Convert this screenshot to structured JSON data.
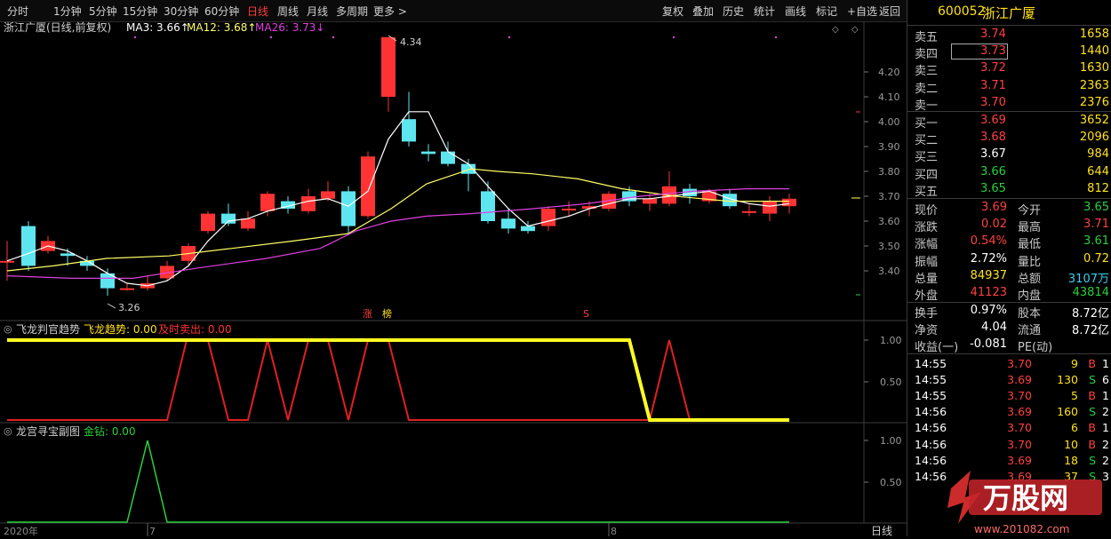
{
  "toolbar": {
    "periods": [
      "分时",
      "1分钟",
      "5分钟",
      "15分钟",
      "30分钟",
      "60分钟",
      "日线",
      "周线",
      "月线",
      "多周期",
      "更多 >"
    ],
    "active_period": "日线",
    "actions": [
      "复权",
      "叠加",
      "历史",
      "统计",
      "画线",
      "标记",
      "+自选",
      "返回"
    ]
  },
  "stock": {
    "code": "600052",
    "name": "浙江广厦"
  },
  "main_chart": {
    "legend_title": "浙江广厦(日线,前复权)",
    "ma3": "MA3: 3.66↑",
    "ma12": "MA12: 3.68↑",
    "ma26": "MA26: 3.73↓",
    "high_label": "4.34",
    "low_label": "3.26",
    "y_ticks": [
      "4.20",
      "4.10",
      "4.00",
      "3.90",
      "3.80",
      "3.70",
      "3.60",
      "3.50",
      "3.40"
    ],
    "marker_zhang": "涨",
    "marker_bang": "榜",
    "marker_s": "S",
    "colors": {
      "up": "#ff3333",
      "down": "#5ee6f0",
      "ma3": "#ffffff",
      "ma12": "#ffff66",
      "ma26": "#e040e0"
    }
  },
  "sub_chart1": {
    "title": "飞龙判官趋势",
    "trend_label": "飞龙趋势: 0.00",
    "sell_label": "及时卖出: 0.00",
    "y_ticks": [
      "1.00",
      "0.50"
    ]
  },
  "sub_chart2": {
    "title": "龙宫寻宝副图",
    "gold_label": "金钻: 0.00",
    "y_ticks": [
      "1.00",
      "0.50"
    ]
  },
  "x_axis": {
    "labels": [
      "2020年",
      "7",
      "8"
    ],
    "period_label": "日线"
  },
  "order_book": {
    "sell": [
      {
        "label": "卖五",
        "price": "3.74",
        "vol": "1658"
      },
      {
        "label": "卖四",
        "price": "3.73",
        "vol": "1440"
      },
      {
        "label": "卖三",
        "price": "3.72",
        "vol": "1630"
      },
      {
        "label": "卖二",
        "price": "3.71",
        "vol": "2363"
      },
      {
        "label": "卖一",
        "price": "3.70",
        "vol": "2376"
      }
    ],
    "buy": [
      {
        "label": "买一",
        "price": "3.69",
        "vol": "3652"
      },
      {
        "label": "买二",
        "price": "3.68",
        "vol": "2096"
      },
      {
        "label": "买三",
        "price": "3.67",
        "vol": "984"
      },
      {
        "label": "买四",
        "price": "3.66",
        "vol": "644"
      },
      {
        "label": "买五",
        "price": "3.65",
        "vol": "812"
      }
    ]
  },
  "quote": {
    "xianjia_l": "现价",
    "xianjia": "3.69",
    "jinkai_l": "今开",
    "jinkai": "3.65",
    "zhangdie_l": "涨跌",
    "zhangdie": "0.02",
    "zuigao_l": "最高",
    "zuigao": "3.71",
    "zhangfu_l": "涨幅",
    "zhangfu": "0.54%",
    "zuidi_l": "最低",
    "zuidi": "3.61",
    "zhenfu_l": "振幅",
    "zhenfu": "2.72%",
    "liangbi_l": "量比",
    "liangbi": "0.72",
    "zongliang_l": "总量",
    "zongliang": "84937",
    "zonge_l": "总额",
    "zonge": "3107万",
    "waipan_l": "外盘",
    "waipan": "41123",
    "neipan_l": "内盘",
    "neipan": "43814",
    "huanshou_l": "换手",
    "huanshou": "0.97%",
    "guben_l": "股本",
    "guben": "8.72亿",
    "jingzi_l": "净资",
    "jingzi": "4.04",
    "liutong_l": "流通",
    "liutong": "8.72亿",
    "shouyi_l": "收益(一)",
    "shouyi": "-0.081",
    "pe_l": "PE(动)",
    "pe": ""
  },
  "ticks": [
    {
      "time": "14:55",
      "price": "3.70",
      "vol": "9",
      "side": "B",
      "n": "1"
    },
    {
      "time": "14:55",
      "price": "3.69",
      "vol": "130",
      "side": "S",
      "n": "6"
    },
    {
      "time": "14:55",
      "price": "3.70",
      "vol": "5",
      "side": "B",
      "n": "1"
    },
    {
      "time": "14:56",
      "price": "3.69",
      "vol": "160",
      "side": "S",
      "n": "2"
    },
    {
      "time": "14:56",
      "price": "3.70",
      "vol": "6",
      "side": "B",
      "n": "1"
    },
    {
      "time": "14:56",
      "price": "3.70",
      "vol": "10",
      "side": "B",
      "n": "2"
    },
    {
      "time": "14:56",
      "price": "3.69",
      "vol": "18",
      "side": "S",
      "n": "2"
    },
    {
      "time": "14:56",
      "price": "3.69",
      "vol": "37",
      "side": "S",
      "n": "3"
    }
  ],
  "watermark": {
    "text": "万股网",
    "url": "www.201082.com"
  }
}
